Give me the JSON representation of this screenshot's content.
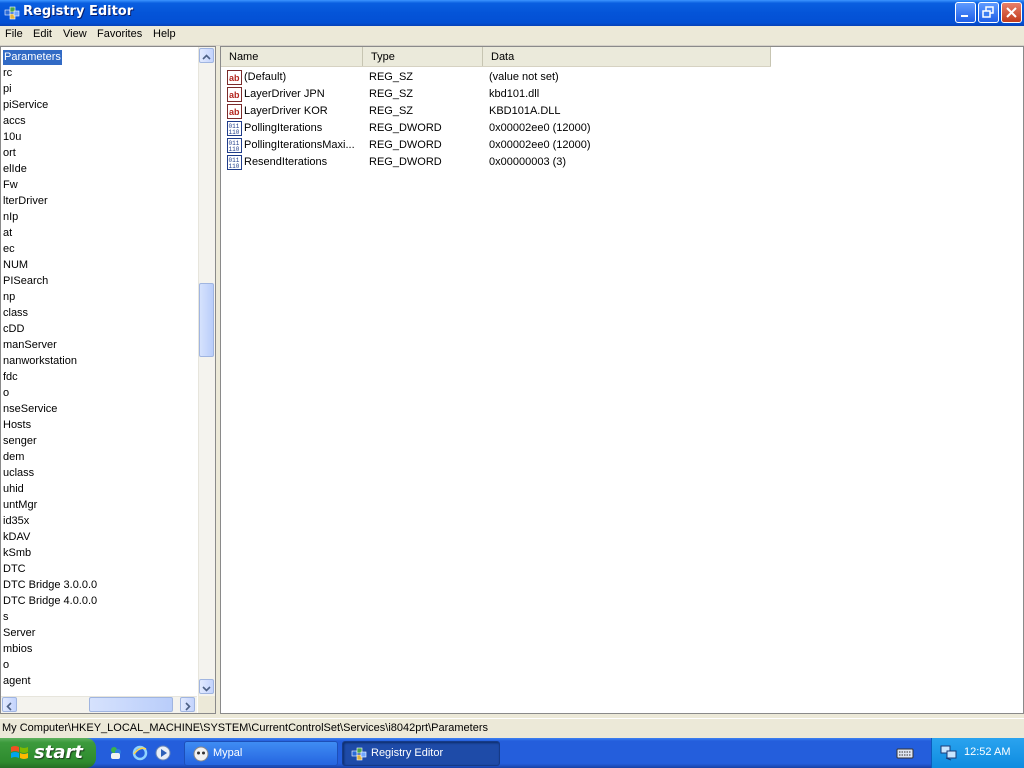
{
  "window": {
    "title": "Registry Editor"
  },
  "menu": [
    "File",
    "Edit",
    "View",
    "Favorites",
    "Help"
  ],
  "tree": {
    "items": [
      "Parameters",
      "rc",
      "pi",
      "piService",
      "accs",
      "10u",
      "ort",
      "elIde",
      "Fw",
      "lterDriver",
      "nIp",
      "at",
      "ec",
      "NUM",
      "PISearch",
      "np",
      "class",
      "cDD",
      "manServer",
      "nanworkstation",
      "fdc",
      "o",
      "nseService",
      "Hosts",
      "senger",
      "dem",
      "uclass",
      "uhid",
      "untMgr",
      "id35x",
      "kDAV",
      "kSmb",
      "DTC",
      "DTC Bridge 3.0.0.0",
      "DTC Bridge 4.0.0.0",
      "s",
      "Server",
      "mbios",
      "o",
      "agent"
    ],
    "selected_index": 0
  },
  "values": {
    "columns": [
      "Name",
      "Type",
      "Data"
    ],
    "rows": [
      {
        "icon": "string-value-icon",
        "name": "(Default)",
        "type": "REG_SZ",
        "data": "(value not set)"
      },
      {
        "icon": "string-value-icon",
        "name": "LayerDriver JPN",
        "type": "REG_SZ",
        "data": "kbd101.dll"
      },
      {
        "icon": "string-value-icon",
        "name": "LayerDriver KOR",
        "type": "REG_SZ",
        "data": "KBD101A.DLL"
      },
      {
        "icon": "binary-value-icon",
        "name": "PollingIterations",
        "type": "REG_DWORD",
        "data": "0x00002ee0 (12000)"
      },
      {
        "icon": "binary-value-icon",
        "name": "PollingIterationsMaxi...",
        "type": "REG_DWORD",
        "data": "0x00002ee0 (12000)"
      },
      {
        "icon": "binary-value-icon",
        "name": "ResendIterations",
        "type": "REG_DWORD",
        "data": "0x00000003 (3)"
      }
    ]
  },
  "status": {
    "path": "My Computer\\HKEY_LOCAL_MACHINE\\SYSTEM\\CurrentControlSet\\Services\\i8042prt\\Parameters"
  },
  "taskbar": {
    "start_label": "start",
    "tasks": [
      {
        "label": "Mypal",
        "active": false
      },
      {
        "label": "Registry Editor",
        "active": true
      }
    ],
    "clock": "12:52 AM"
  },
  "colors": {
    "titlebar": "#0454d8",
    "selection": "#316ac5",
    "taskbar": "#245edc",
    "start": "#3c9a3c"
  }
}
